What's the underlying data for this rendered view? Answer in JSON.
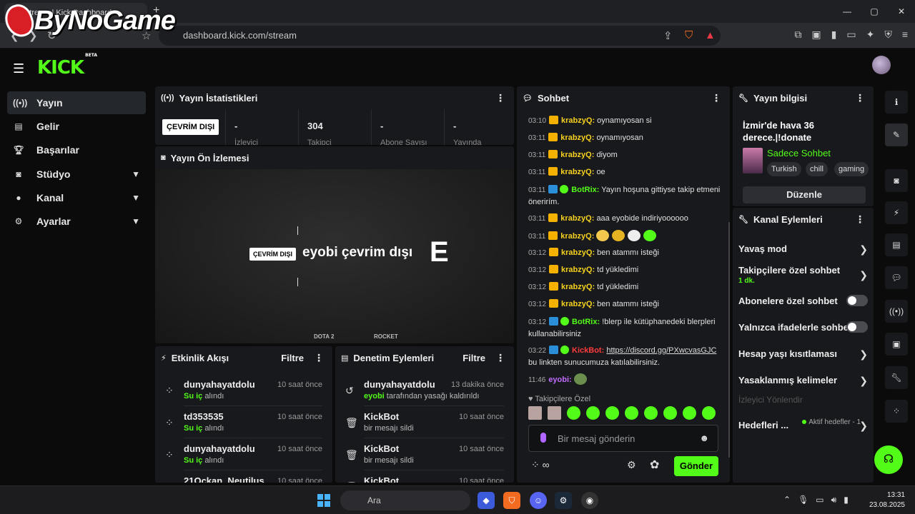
{
  "browser": {
    "tab_title": "Stream | Kick Dashboard",
    "url": "dashboard.kick.com/stream",
    "new_tab": "+",
    "min": "—",
    "max": "▢",
    "close": "✕"
  },
  "watermark": "ByNoGame",
  "app": {
    "logo": "KICK",
    "logo_badge": "BETA"
  },
  "sidebar": {
    "items": [
      {
        "label": "Yayın",
        "icon": "broadcast-icon"
      },
      {
        "label": "Gelir",
        "icon": "chart-icon"
      },
      {
        "label": "Başarılar",
        "icon": "trophy-icon"
      },
      {
        "label": "Stüdyo",
        "icon": "camera-icon"
      },
      {
        "label": "Kanal",
        "icon": "user-icon"
      },
      {
        "label": "Ayarlar",
        "icon": "gear-icon"
      }
    ]
  },
  "stats": {
    "title": "Yayın İstatistikleri",
    "status": "ÇEVRİM DIŞI",
    "cells": [
      {
        "value": "-",
        "label": "İzleyici"
      },
      {
        "value": "304",
        "label": "Takipçi"
      },
      {
        "value": "-",
        "label": "Abone Sayısı"
      },
      {
        "value": "-",
        "label": "Yayında"
      }
    ]
  },
  "preview": {
    "title": "Yayın Ön İzlemesi",
    "badge": "ÇEVRİM DIŞI",
    "text": "eyobi çevrim dışı",
    "letter": "E",
    "sponsors": [
      "DOTA 2",
      "ROCKET"
    ]
  },
  "activity": {
    "title": "Etkinlik Akışı",
    "filter": "Filtre",
    "items": [
      {
        "name": "dunyahayatdolu",
        "item": "Su iç",
        "suffix": "alındı",
        "time": "10 saat önce"
      },
      {
        "name": "td353535",
        "item": "Su iç",
        "suffix": "alındı",
        "time": "10 saat önce"
      },
      {
        "name": "dunyahayatdolu",
        "item": "Su iç",
        "suffix": "alındı",
        "time": "10 saat önce"
      },
      {
        "name": "21Ockan_Neutilus",
        "item": "",
        "suffix": "",
        "time": "10 saat önce"
      }
    ]
  },
  "moderation": {
    "title": "Denetim Eylemleri",
    "filter": "Filtre",
    "items": [
      {
        "name": "dunyahayatdolu",
        "actor": "eyobi",
        "text": "tarafından yasağı kaldırıldı",
        "time": "13 dakika önce"
      },
      {
        "name": "KickBot",
        "actor": "",
        "text": "bir mesajı sildi",
        "time": "10 saat önce"
      },
      {
        "name": "KickBot",
        "actor": "",
        "text": "bir mesajı sildi",
        "time": "10 saat önce"
      },
      {
        "name": "KickBot",
        "actor": "",
        "text": "",
        "time": "10 saat önce"
      }
    ]
  },
  "chat": {
    "title": "Sohbet",
    "messages": [
      {
        "time": "03:10",
        "user": "krabzyQ:",
        "text": "oynamıyosan si"
      },
      {
        "time": "03:11",
        "user": "krabzyQ:",
        "text": "oynamıyosan"
      },
      {
        "time": "03:11",
        "user": "krabzyQ:",
        "text": "diyom"
      },
      {
        "time": "03:11",
        "user": "krabzyQ:",
        "text": "oe"
      },
      {
        "time": "03:11",
        "user": "BotRix:",
        "text": "Yayın hoşuna gittiyse takip etmeni önerirím."
      },
      {
        "time": "03:11",
        "user": "krabzyQ:",
        "text": "aaa eyobide indiriyoooooo"
      },
      {
        "time": "03:11",
        "user": "krabzyQ:",
        "text": ""
      },
      {
        "time": "03:12",
        "user": "krabzyQ:",
        "text": "ben atammı isteği"
      },
      {
        "time": "03:12",
        "user": "krabzyQ:",
        "text": "td yükledimi"
      },
      {
        "time": "03:12",
        "user": "krabzyQ:",
        "text": "td yükledimi"
      },
      {
        "time": "03:12",
        "user": "krabzyQ:",
        "text": "ben atammı isteği"
      },
      {
        "time": "03:12",
        "user": "BotRix:",
        "text": "!blerp ile kütüphanedeki blerpleri kullanabilirsiniz"
      },
      {
        "time": "03:22",
        "user": "KickBot:",
        "link": "https://discord.gg/PXwcvasGJC",
        "text": "bu linkten sunucumuza katılabilirsiniz."
      },
      {
        "time": "11:46",
        "user": "eyobi:",
        "text": ""
      }
    ],
    "subs_only": "♥ Takipçilere Özel",
    "placeholder": "Bir mesaj gönderin",
    "send": "Gönder",
    "infinity": "∞"
  },
  "info": {
    "title": "Yayın bilgisi",
    "stream_title": "İzmir'de hava 36 derece.|!donate",
    "category": "Sadece Sohbet",
    "tags": [
      "Turkish",
      "chill",
      "gaming"
    ],
    "edit": "Düzenle"
  },
  "channel_actions": {
    "title": "Kanal Eylemleri",
    "items": [
      {
        "label": "Yavaş mod",
        "kind": "chevron"
      },
      {
        "label": "Takipçilere özel sohbet",
        "sub": "1 dk.",
        "kind": "chevron"
      },
      {
        "label": "Abonelere özel sohbet",
        "kind": "toggle"
      },
      {
        "label": "Yalnızca ifadelerle sohbet",
        "kind": "toggle"
      },
      {
        "label": "Hesap yaşı kısıtlaması",
        "kind": "chevron"
      },
      {
        "label": "Yasaklanmış kelimeler",
        "kind": "chevron"
      }
    ],
    "viewer_direction": "İzleyici Yönlendir",
    "goals_label": "Hedefleri ...",
    "goals_note": "Aktif hedefler - 1"
  },
  "taskbar": {
    "search": "Ara",
    "time": "13:31",
    "date": "23.08.2025"
  },
  "colors": {
    "kick_green": "#53fc18",
    "panel": "#18191c",
    "crown": "#f5b100"
  }
}
